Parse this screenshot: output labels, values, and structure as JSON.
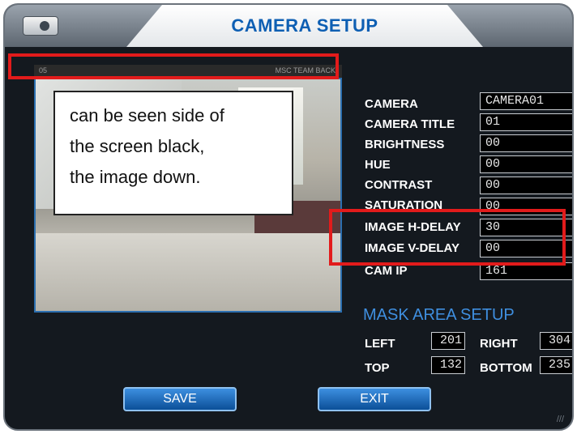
{
  "header": {
    "title": "CAMERA SETUP"
  },
  "preview": {
    "strip_left": "05",
    "strip_right": "MSC TEAM BACK"
  },
  "annotation": {
    "lines": [
      "can be seen side of",
      "the screen black,",
      "the image down."
    ]
  },
  "fields": [
    {
      "label": "CAMERA",
      "value": "CAMERA01"
    },
    {
      "label": "CAMERA TITLE",
      "value": "01"
    },
    {
      "label": "BRIGHTNESS",
      "value": "00"
    },
    {
      "label": "HUE",
      "value": "00"
    },
    {
      "label": "CONTRAST",
      "value": "00"
    },
    {
      "label": "SATURATION",
      "value": "00"
    },
    {
      "label": "IMAGE H-DELAY",
      "value": "30"
    },
    {
      "label": "IMAGE V-DELAY",
      "value": "00"
    },
    {
      "label": "CAM IP",
      "value": "161"
    }
  ],
  "mask": {
    "title": "MASK AREA SETUP",
    "left_label": "LEFT",
    "left_value": "201",
    "right_label": "RIGHT",
    "right_value": "304",
    "top_label": "TOP",
    "top_value": "132",
    "bottom_label": "BOTTOM",
    "bottom_value": "235"
  },
  "buttons": {
    "save": "SAVE",
    "exit": "EXIT"
  },
  "colors": {
    "highlight": "#e21b1b",
    "accent": "#0e5fb3"
  }
}
